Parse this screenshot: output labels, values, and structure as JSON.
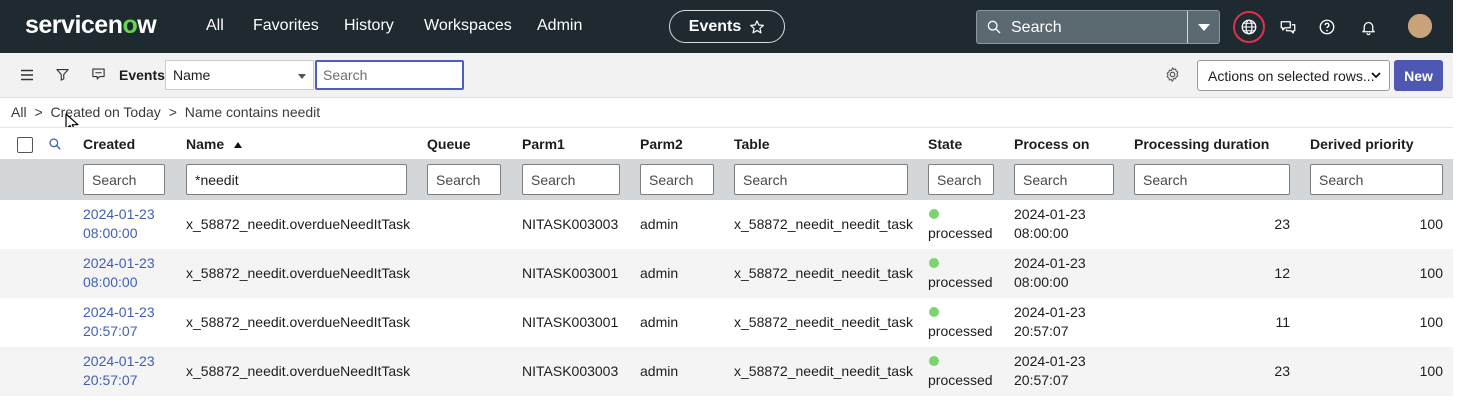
{
  "nav": {
    "logo_main": "servicen",
    "logo_o": "o",
    "logo_end": "w",
    "links": [
      "All",
      "Favorites",
      "History",
      "Workspaces",
      "Admin"
    ],
    "context_title": "Events",
    "search_placeholder": "Search"
  },
  "toolbar": {
    "title": "Events",
    "field_select": "Name",
    "search_placeholder": "Search",
    "actions_label": "Actions on selected rows...",
    "new_label": "New"
  },
  "breadcrumb": [
    "All",
    ">",
    "Created on Today",
    ">",
    "Name contains needit"
  ],
  "table": {
    "columns": [
      "Created",
      "Name",
      "Queue",
      "Parm1",
      "Parm2",
      "Table",
      "State",
      "Process on",
      "Processing duration",
      "Derived priority"
    ],
    "filters": {
      "created": "",
      "name": "*needit",
      "queue": "",
      "parm1": "",
      "parm2": "",
      "table": "",
      "state": "",
      "process_on": "",
      "duration": "",
      "priority": "",
      "placeholder": "Search"
    },
    "rows": [
      {
        "created_date": "2024-01-23",
        "created_time": "08:00:00",
        "name": "x_58872_needit.overdueNeedItTask",
        "queue": "",
        "parm1": "NITASK003003",
        "parm2": "admin",
        "table": "x_58872_needit_needit_task",
        "state": "processed",
        "proc_date": "2024-01-23",
        "proc_time": "08:00:00",
        "duration": "23",
        "priority": "100"
      },
      {
        "created_date": "2024-01-23",
        "created_time": "08:00:00",
        "name": "x_58872_needit.overdueNeedItTask",
        "queue": "",
        "parm1": "NITASK003001",
        "parm2": "admin",
        "table": "x_58872_needit_needit_task",
        "state": "processed",
        "proc_date": "2024-01-23",
        "proc_time": "08:00:00",
        "duration": "12",
        "priority": "100"
      },
      {
        "created_date": "2024-01-23",
        "created_time": "20:57:07",
        "name": "x_58872_needit.overdueNeedItTask",
        "queue": "",
        "parm1": "NITASK003001",
        "parm2": "admin",
        "table": "x_58872_needit_needit_task",
        "state": "processed",
        "proc_date": "2024-01-23",
        "proc_time": "20:57:07",
        "duration": "11",
        "priority": "100"
      },
      {
        "created_date": "2024-01-23",
        "created_time": "20:57:07",
        "name": "x_58872_needit.overdueNeedItTask",
        "queue": "",
        "parm1": "NITASK003003",
        "parm2": "admin",
        "table": "x_58872_needit_needit_task",
        "state": "processed",
        "proc_date": "2024-01-23",
        "proc_time": "20:57:07",
        "duration": "23",
        "priority": "100"
      }
    ]
  },
  "colors": {
    "nav_bg": "#1e2a30",
    "accent": "#4e58b3",
    "link": "#3f5fb7",
    "state_ok": "#7cd46e",
    "alert_ring": "#e0324b"
  }
}
